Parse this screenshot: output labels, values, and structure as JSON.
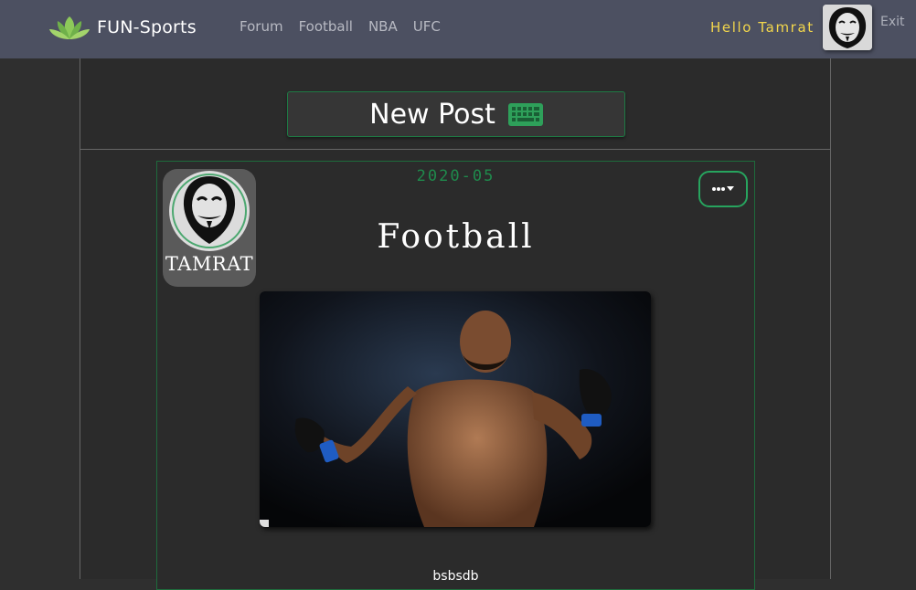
{
  "navbar": {
    "brand_name": "FUN-Sports",
    "links": [
      "Forum",
      "Football",
      "NBA",
      "UFC"
    ],
    "greeting": "Hello Tamrat",
    "exit_label": "Exit"
  },
  "composer": {
    "new_post_label": "New Post",
    "icon": "keyboard-icon"
  },
  "post": {
    "date": "2020-05",
    "author": "TAMRAT",
    "title": "Football",
    "body": "bsbsdb",
    "menu_icon": "more-dropdown-icon"
  },
  "colors": {
    "navbar_bg": "#4c5061",
    "page_bg": "#2f2f2f",
    "accent_green": "#1f8a4c",
    "greeting_yellow": "#f2d64c"
  }
}
